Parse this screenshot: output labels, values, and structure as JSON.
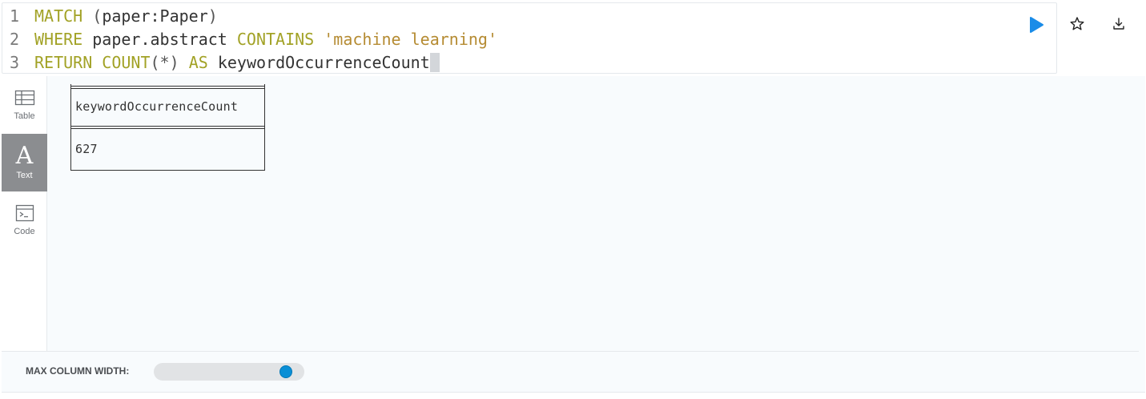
{
  "editor": {
    "lines": [
      {
        "num": "1",
        "tokens": [
          {
            "t": "MATCH",
            "c": "kw"
          },
          {
            "t": " (",
            "c": "punct"
          },
          {
            "t": "paper:Paper",
            "c": "ident"
          },
          {
            "t": ")",
            "c": "punct"
          }
        ]
      },
      {
        "num": "2",
        "tokens": [
          {
            "t": "WHERE",
            "c": "kw"
          },
          {
            "t": " paper.abstract ",
            "c": "ident"
          },
          {
            "t": "CONTAINS",
            "c": "kw"
          },
          {
            "t": " ",
            "c": "ident"
          },
          {
            "t": "'machine learning'",
            "c": "str"
          }
        ]
      },
      {
        "num": "3",
        "tokens": [
          {
            "t": "RETURN",
            "c": "kw"
          },
          {
            "t": " ",
            "c": "ident"
          },
          {
            "t": "COUNT",
            "c": "kw"
          },
          {
            "t": "(*)",
            "c": "punct"
          },
          {
            "t": " ",
            "c": "ident"
          },
          {
            "t": "AS",
            "c": "kw"
          },
          {
            "t": " keywordOccurrenceCount",
            "c": "ident"
          }
        ]
      }
    ],
    "colors": {
      "keyword": "#a2a226",
      "string": "#b58b32",
      "run": "#1a8ce8"
    }
  },
  "toolbar": {
    "run_icon": "play-icon",
    "star_icon": "star-icon",
    "download_icon": "download-icon"
  },
  "sidebar": {
    "tabs": [
      {
        "label": "Table",
        "icon": "table-icon",
        "active": false
      },
      {
        "label": "Text",
        "icon": "text-icon",
        "active": true,
        "glyph": "A"
      },
      {
        "label": "Code",
        "icon": "code-icon",
        "active": false
      }
    ]
  },
  "result": {
    "column_header": "keywordOccurrenceCount",
    "rows": [
      "627"
    ]
  },
  "footer": {
    "label": "MAX COLUMN WIDTH:",
    "slider_value_fraction": 0.94
  }
}
